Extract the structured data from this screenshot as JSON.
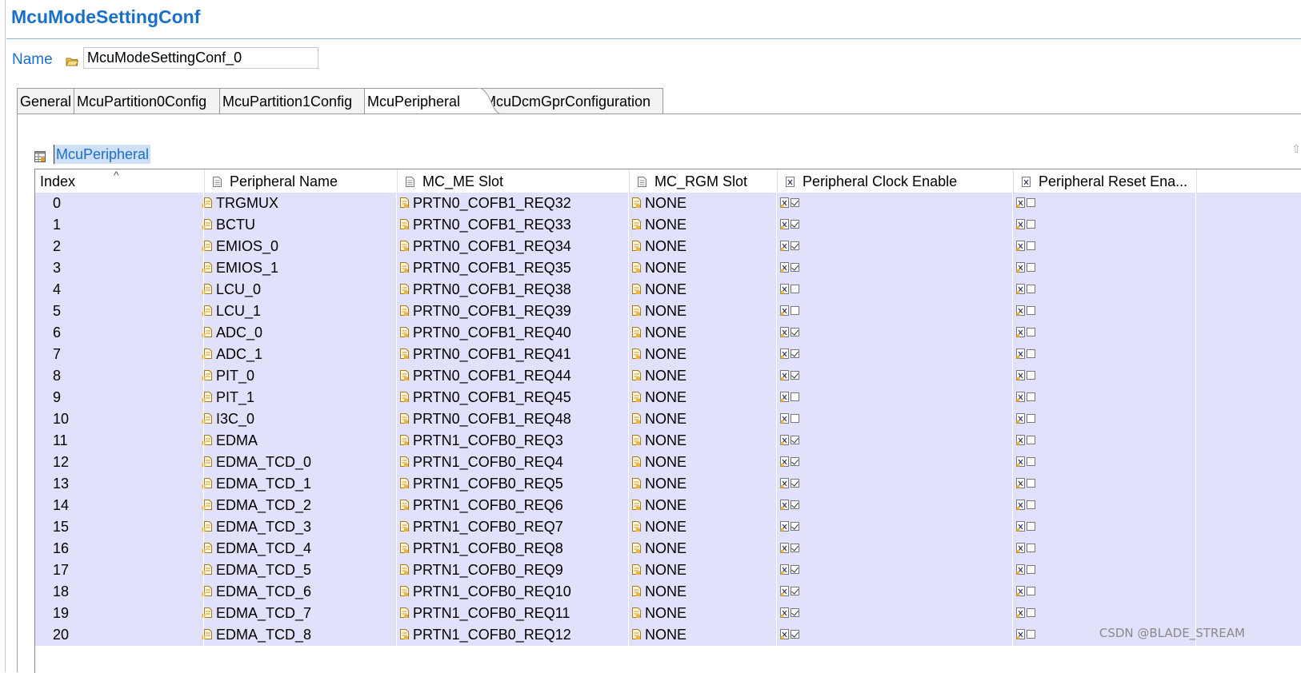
{
  "title": "McuModeSettingConf",
  "name_label": "Name",
  "name_value": "McuModeSettingConf_0",
  "tabs": [
    "General",
    "McuPartition0Config",
    "McuPartition1Config",
    "McuPeripheral",
    "McuDcmGprConfiguration"
  ],
  "active_tab": "McuPeripheral",
  "section_label": "McuPeripheral",
  "columns": [
    "Index",
    "Peripheral Name",
    "MC_ME Slot",
    "MC_RGM Slot",
    "Peripheral Clock Enable",
    "Peripheral Reset Ena..."
  ],
  "rows": [
    {
      "index": "0",
      "name": "TRGMUX",
      "me": "PRTN0_COFB1_REQ32",
      "rgm": "NONE",
      "clk": true,
      "rst": false
    },
    {
      "index": "1",
      "name": "BCTU",
      "me": "PRTN0_COFB1_REQ33",
      "rgm": "NONE",
      "clk": true,
      "rst": false
    },
    {
      "index": "2",
      "name": "EMIOS_0",
      "me": "PRTN0_COFB1_REQ34",
      "rgm": "NONE",
      "clk": true,
      "rst": false
    },
    {
      "index": "3",
      "name": "EMIOS_1",
      "me": "PRTN0_COFB1_REQ35",
      "rgm": "NONE",
      "clk": true,
      "rst": false
    },
    {
      "index": "4",
      "name": "LCU_0",
      "me": "PRTN0_COFB1_REQ38",
      "rgm": "NONE",
      "clk": false,
      "rst": false
    },
    {
      "index": "5",
      "name": "LCU_1",
      "me": "PRTN0_COFB1_REQ39",
      "rgm": "NONE",
      "clk": false,
      "rst": false
    },
    {
      "index": "6",
      "name": "ADC_0",
      "me": "PRTN0_COFB1_REQ40",
      "rgm": "NONE",
      "clk": true,
      "rst": false
    },
    {
      "index": "7",
      "name": "ADC_1",
      "me": "PRTN0_COFB1_REQ41",
      "rgm": "NONE",
      "clk": true,
      "rst": false
    },
    {
      "index": "8",
      "name": "PIT_0",
      "me": "PRTN0_COFB1_REQ44",
      "rgm": "NONE",
      "clk": true,
      "rst": false
    },
    {
      "index": "9",
      "name": "PIT_1",
      "me": "PRTN0_COFB1_REQ45",
      "rgm": "NONE",
      "clk": false,
      "rst": false
    },
    {
      "index": "10",
      "name": "I3C_0",
      "me": "PRTN0_COFB1_REQ48",
      "rgm": "NONE",
      "clk": false,
      "rst": false
    },
    {
      "index": "11",
      "name": "EDMA",
      "me": "PRTN1_COFB0_REQ3",
      "rgm": "NONE",
      "clk": true,
      "rst": false
    },
    {
      "index": "12",
      "name": "EDMA_TCD_0",
      "me": "PRTN1_COFB0_REQ4",
      "rgm": "NONE",
      "clk": true,
      "rst": false
    },
    {
      "index": "13",
      "name": "EDMA_TCD_1",
      "me": "PRTN1_COFB0_REQ5",
      "rgm": "NONE",
      "clk": true,
      "rst": false
    },
    {
      "index": "14",
      "name": "EDMA_TCD_2",
      "me": "PRTN1_COFB0_REQ6",
      "rgm": "NONE",
      "clk": true,
      "rst": false
    },
    {
      "index": "15",
      "name": "EDMA_TCD_3",
      "me": "PRTN1_COFB0_REQ7",
      "rgm": "NONE",
      "clk": true,
      "rst": false
    },
    {
      "index": "16",
      "name": "EDMA_TCD_4",
      "me": "PRTN1_COFB0_REQ8",
      "rgm": "NONE",
      "clk": true,
      "rst": false
    },
    {
      "index": "17",
      "name": "EDMA_TCD_5",
      "me": "PRTN1_COFB0_REQ9",
      "rgm": "NONE",
      "clk": true,
      "rst": false
    },
    {
      "index": "18",
      "name": "EDMA_TCD_6",
      "me": "PRTN1_COFB0_REQ10",
      "rgm": "NONE",
      "clk": true,
      "rst": false
    },
    {
      "index": "19",
      "name": "EDMA_TCD_7",
      "me": "PRTN1_COFB0_REQ11",
      "rgm": "NONE",
      "clk": true,
      "rst": false
    },
    {
      "index": "20",
      "name": "EDMA_TCD_8",
      "me": "PRTN1_COFB0_REQ12",
      "rgm": "NONE",
      "clk": true,
      "rst": false
    }
  ],
  "watermark": "CSDN @BLADE_STREAM",
  "colors": {
    "accent": "#1a6fc9",
    "row_bg": "#e1e1fb",
    "selection_bg": "#cfe0f6"
  },
  "icons": {
    "name_field": "folder-open-icon",
    "section": "table-icon",
    "column": "document-icon",
    "enum_cell": "enum-icon",
    "bool_cell": "boolean-icon"
  }
}
